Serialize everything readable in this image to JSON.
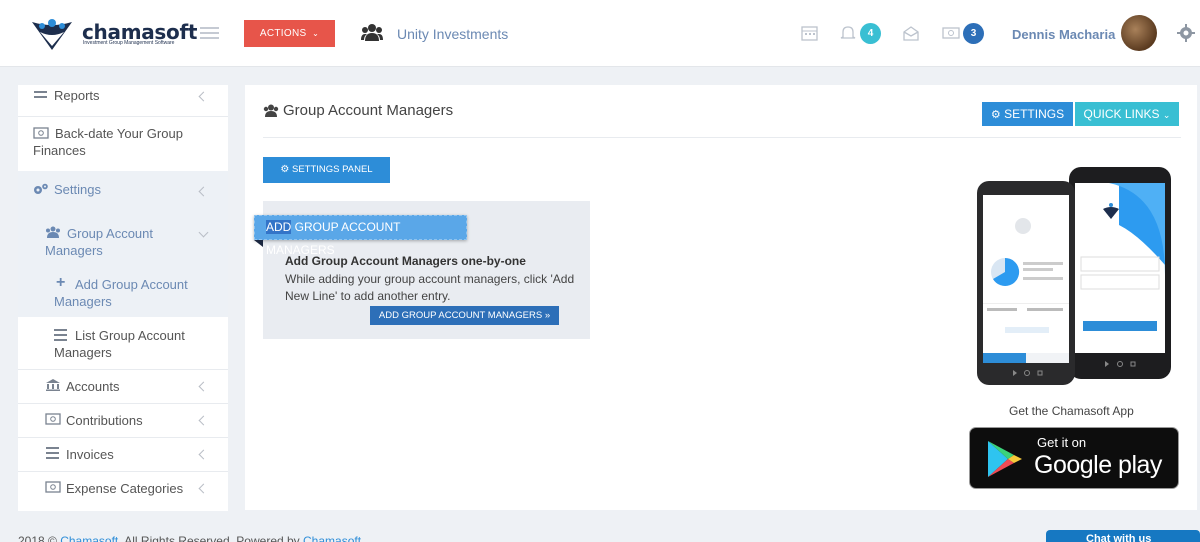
{
  "header": {
    "logo_text": "chamasoft",
    "logo_tagline": "Investment Group Management Software",
    "actions_label": "ACTIONS",
    "group_name": "Unity Investments",
    "notifications_count": "4",
    "messages_count": "3",
    "user_name": "Dennis Macharia"
  },
  "sidebar": {
    "items": [
      {
        "label": "Reports"
      },
      {
        "label": "Back-date Your Group Finances"
      },
      {
        "label": "Settings"
      },
      {
        "label": "Group Account Managers"
      },
      {
        "label": "Add Group Account Managers"
      },
      {
        "label": "List Group Account Managers"
      },
      {
        "label": "Accounts"
      },
      {
        "label": "Contributions"
      },
      {
        "label": "Invoices"
      },
      {
        "label": "Expense Categories"
      }
    ]
  },
  "main": {
    "title": "Group Account Managers",
    "settings_label": "SETTINGS",
    "quick_links_label": "QUICK LINKS",
    "settings_panel_label": "SETTINGS PANEL",
    "ribbon_highlight": "ADD",
    "ribbon_rest": " GROUP ACCOUNT MANAGERS",
    "info_heading": "Add Group Account Managers one-by-one",
    "info_text": "While adding your group account managers, click 'Add New Line' to add another entry.",
    "add_button_label": "ADD GROUP ACCOUNT MANAGERS »",
    "app_caption": "Get the Chamasoft App",
    "gplay_small": "Get it on",
    "gplay_big": "Google play"
  },
  "footer": {
    "copyright": "2018 © ",
    "brand": "Chamasoft",
    "rights": ". All Rights Reserved. Powered by ",
    "powered_brand": "Chamasoft"
  },
  "chat": {
    "label": "Chat with us"
  },
  "colors": {
    "actions": "#e7554a",
    "primary": "#2d8dd8",
    "quick_links": "#39bfd3",
    "badge_notifications": "#39bfd3",
    "badge_messages": "#2d6fb8"
  }
}
